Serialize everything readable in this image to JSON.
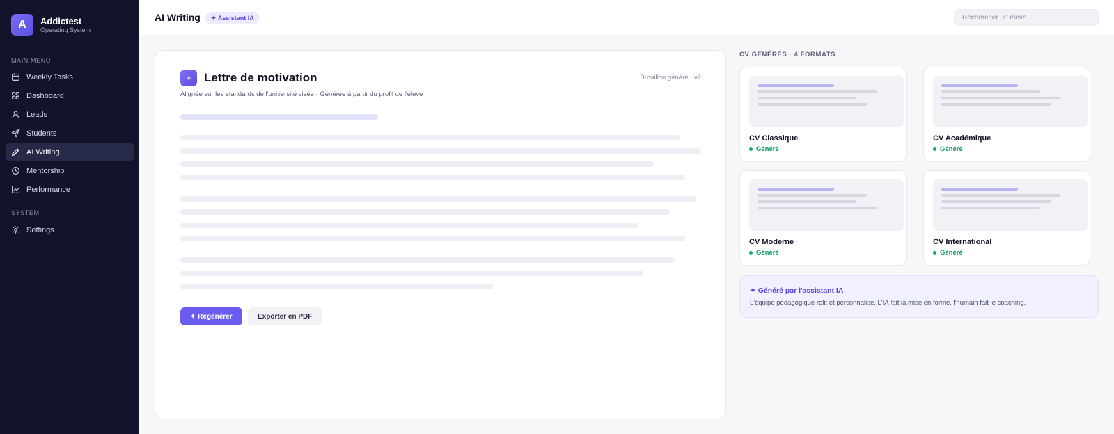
{
  "brand": {
    "initial": "A",
    "name": "Addictest",
    "subtitle": "Operating System"
  },
  "sidebar": {
    "main_label": "MAIN MENU",
    "system_label": "SYSTEM",
    "items": [
      {
        "label": "Weekly Tasks",
        "icon": "calendar-icon"
      },
      {
        "label": "Dashboard",
        "icon": "grid-icon"
      },
      {
        "label": "Leads",
        "icon": "user-icon"
      },
      {
        "label": "Students",
        "icon": "send-icon"
      },
      {
        "label": "AI Writing",
        "icon": "pen-icon",
        "active": true
      },
      {
        "label": "Mentorship",
        "icon": "clock-icon"
      },
      {
        "label": "Performance",
        "icon": "chart-icon"
      }
    ],
    "system_items": [
      {
        "label": "Settings",
        "icon": "gear-icon"
      }
    ]
  },
  "header": {
    "title": "AI Writing",
    "badge": "✦ Assistant IA",
    "search_placeholder": "Rechercher un élève..."
  },
  "letter": {
    "icon": "+",
    "title": "Lettre de motivation",
    "meta": "Brouillon généré · v2",
    "subtitle": "Alignée sur les standards de l'université visée · Générée à partir du profil de l'élève",
    "regenerate_label": "✦ Régénérer",
    "export_label": "Exporter en PDF"
  },
  "cv": {
    "heading": "CV GÉNÉRÉS · 4 FORMATS",
    "items": [
      {
        "name": "CV Classique",
        "status": "Généré"
      },
      {
        "name": "CV Académique",
        "status": "Généré"
      },
      {
        "name": "CV Moderne",
        "status": "Généré"
      },
      {
        "name": "CV International",
        "status": "Généré"
      }
    ]
  },
  "ai_note": {
    "title": "✦ Généré par l'assistant IA",
    "text": "L'équipe pédagogique relit et personnalise. L'IA fait la mise en forme, l'humain fait le coaching."
  },
  "colors": {
    "accent": "#6b5cf0",
    "sidebar_bg": "#12142b",
    "success": "#159a6b"
  }
}
